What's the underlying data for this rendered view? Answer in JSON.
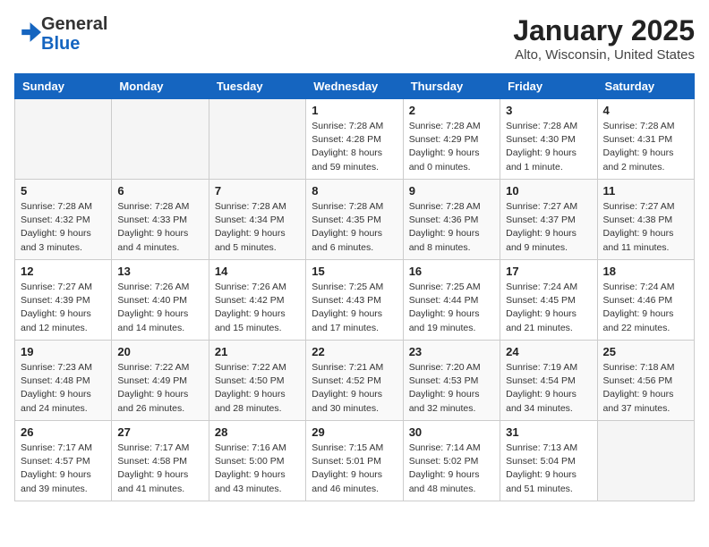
{
  "logo": {
    "general": "General",
    "blue": "Blue"
  },
  "header": {
    "title": "January 2025",
    "location": "Alto, Wisconsin, United States"
  },
  "days_of_week": [
    "Sunday",
    "Monday",
    "Tuesday",
    "Wednesday",
    "Thursday",
    "Friday",
    "Saturday"
  ],
  "weeks": [
    [
      {
        "day": "",
        "info": ""
      },
      {
        "day": "",
        "info": ""
      },
      {
        "day": "",
        "info": ""
      },
      {
        "day": "1",
        "info": "Sunrise: 7:28 AM\nSunset: 4:28 PM\nDaylight: 8 hours and 59 minutes."
      },
      {
        "day": "2",
        "info": "Sunrise: 7:28 AM\nSunset: 4:29 PM\nDaylight: 9 hours and 0 minutes."
      },
      {
        "day": "3",
        "info": "Sunrise: 7:28 AM\nSunset: 4:30 PM\nDaylight: 9 hours and 1 minute."
      },
      {
        "day": "4",
        "info": "Sunrise: 7:28 AM\nSunset: 4:31 PM\nDaylight: 9 hours and 2 minutes."
      }
    ],
    [
      {
        "day": "5",
        "info": "Sunrise: 7:28 AM\nSunset: 4:32 PM\nDaylight: 9 hours and 3 minutes."
      },
      {
        "day": "6",
        "info": "Sunrise: 7:28 AM\nSunset: 4:33 PM\nDaylight: 9 hours and 4 minutes."
      },
      {
        "day": "7",
        "info": "Sunrise: 7:28 AM\nSunset: 4:34 PM\nDaylight: 9 hours and 5 minutes."
      },
      {
        "day": "8",
        "info": "Sunrise: 7:28 AM\nSunset: 4:35 PM\nDaylight: 9 hours and 6 minutes."
      },
      {
        "day": "9",
        "info": "Sunrise: 7:28 AM\nSunset: 4:36 PM\nDaylight: 9 hours and 8 minutes."
      },
      {
        "day": "10",
        "info": "Sunrise: 7:27 AM\nSunset: 4:37 PM\nDaylight: 9 hours and 9 minutes."
      },
      {
        "day": "11",
        "info": "Sunrise: 7:27 AM\nSunset: 4:38 PM\nDaylight: 9 hours and 11 minutes."
      }
    ],
    [
      {
        "day": "12",
        "info": "Sunrise: 7:27 AM\nSunset: 4:39 PM\nDaylight: 9 hours and 12 minutes."
      },
      {
        "day": "13",
        "info": "Sunrise: 7:26 AM\nSunset: 4:40 PM\nDaylight: 9 hours and 14 minutes."
      },
      {
        "day": "14",
        "info": "Sunrise: 7:26 AM\nSunset: 4:42 PM\nDaylight: 9 hours and 15 minutes."
      },
      {
        "day": "15",
        "info": "Sunrise: 7:25 AM\nSunset: 4:43 PM\nDaylight: 9 hours and 17 minutes."
      },
      {
        "day": "16",
        "info": "Sunrise: 7:25 AM\nSunset: 4:44 PM\nDaylight: 9 hours and 19 minutes."
      },
      {
        "day": "17",
        "info": "Sunrise: 7:24 AM\nSunset: 4:45 PM\nDaylight: 9 hours and 21 minutes."
      },
      {
        "day": "18",
        "info": "Sunrise: 7:24 AM\nSunset: 4:46 PM\nDaylight: 9 hours and 22 minutes."
      }
    ],
    [
      {
        "day": "19",
        "info": "Sunrise: 7:23 AM\nSunset: 4:48 PM\nDaylight: 9 hours and 24 minutes."
      },
      {
        "day": "20",
        "info": "Sunrise: 7:22 AM\nSunset: 4:49 PM\nDaylight: 9 hours and 26 minutes."
      },
      {
        "day": "21",
        "info": "Sunrise: 7:22 AM\nSunset: 4:50 PM\nDaylight: 9 hours and 28 minutes."
      },
      {
        "day": "22",
        "info": "Sunrise: 7:21 AM\nSunset: 4:52 PM\nDaylight: 9 hours and 30 minutes."
      },
      {
        "day": "23",
        "info": "Sunrise: 7:20 AM\nSunset: 4:53 PM\nDaylight: 9 hours and 32 minutes."
      },
      {
        "day": "24",
        "info": "Sunrise: 7:19 AM\nSunset: 4:54 PM\nDaylight: 9 hours and 34 minutes."
      },
      {
        "day": "25",
        "info": "Sunrise: 7:18 AM\nSunset: 4:56 PM\nDaylight: 9 hours and 37 minutes."
      }
    ],
    [
      {
        "day": "26",
        "info": "Sunrise: 7:17 AM\nSunset: 4:57 PM\nDaylight: 9 hours and 39 minutes."
      },
      {
        "day": "27",
        "info": "Sunrise: 7:17 AM\nSunset: 4:58 PM\nDaylight: 9 hours and 41 minutes."
      },
      {
        "day": "28",
        "info": "Sunrise: 7:16 AM\nSunset: 5:00 PM\nDaylight: 9 hours and 43 minutes."
      },
      {
        "day": "29",
        "info": "Sunrise: 7:15 AM\nSunset: 5:01 PM\nDaylight: 9 hours and 46 minutes."
      },
      {
        "day": "30",
        "info": "Sunrise: 7:14 AM\nSunset: 5:02 PM\nDaylight: 9 hours and 48 minutes."
      },
      {
        "day": "31",
        "info": "Sunrise: 7:13 AM\nSunset: 5:04 PM\nDaylight: 9 hours and 51 minutes."
      },
      {
        "day": "",
        "info": ""
      }
    ]
  ]
}
